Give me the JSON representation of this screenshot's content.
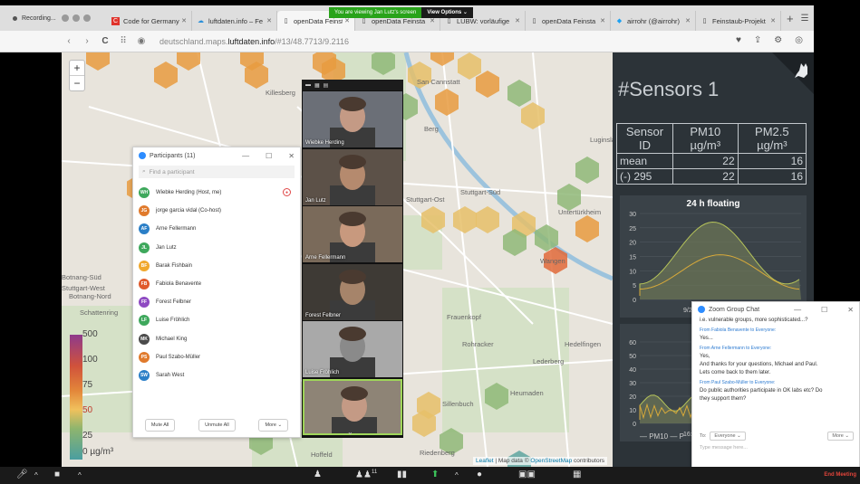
{
  "share_banner": {
    "text": "You are viewing Jan Lutz's screen",
    "button": "View Options ⌄"
  },
  "recording": {
    "label": "Recording..."
  },
  "tabs": [
    {
      "label": "Code for Germany",
      "icon": "code-for-germany-icon",
      "active": false
    },
    {
      "label": "luftdaten.info – Fe",
      "icon": "cloud-icon",
      "active": false
    },
    {
      "label": "openData Feinsta",
      "icon": "page-icon",
      "active": true
    },
    {
      "label": "openData Feinsta",
      "icon": "page-icon",
      "active": false
    },
    {
      "label": "LUBW: vorläufige",
      "icon": "page-icon",
      "active": false
    },
    {
      "label": "openData Feinsta",
      "icon": "page-icon",
      "active": false
    },
    {
      "label": "airrohr (@airrohr)",
      "icon": "twitter-bird-icon",
      "active": false
    },
    {
      "label": "Feinstaub-Projekt",
      "icon": "page-icon",
      "active": false
    }
  ],
  "url": {
    "prefix": "deutschland.maps.",
    "domain": "luftdaten.info",
    "path": "/#13/48.7713/9.2116"
  },
  "map": {
    "labels": [
      "San Cannstatt",
      "Berg",
      "Luginsland",
      "Stuttgart-Ost",
      "Untertürkheim",
      "Wangen",
      "Stuttgart-Süd",
      "Frauenkopf",
      "Rohracker",
      "Hedelfingen",
      "Lederberg",
      "Heumaden",
      "Sillenbuch",
      "Hoffeld",
      "Riedenberg",
      "Botnang-Süd",
      "Stuttgart-West",
      "Botnang-Nord",
      "Schattenring",
      "Killesberg",
      "Stuttgart-Nord"
    ],
    "legend_ticks": [
      "500",
      "100",
      "75",
      "50",
      "25",
      "0 µg/m³"
    ],
    "attribution_leaflet": "Leaflet",
    "attribution_text": " | Map data © ",
    "attribution_osm": "OpenStreetMap",
    "attribution_end": " contributors",
    "zoom_in": "+",
    "zoom_out": "−"
  },
  "sensor_panel": {
    "title": "#Sensors 1",
    "headers": [
      "Sensor ID",
      "PM10 µg/m³",
      "PM2.5 µg/m³"
    ],
    "rows": [
      {
        "id": "mean",
        "pm10": "22",
        "pm25": "16"
      },
      {
        "id": "(-) 295",
        "pm10": "22",
        "pm25": "16"
      }
    ],
    "chart1_title": "24 h floating",
    "chart1_ticks": [
      "30",
      "25",
      "20",
      "15",
      "10",
      "5",
      "0"
    ],
    "chart1_xlabel": "9/2",
    "chart2_title": "La",
    "chart2_ticks": [
      "60",
      "50",
      "40",
      "30",
      "20",
      "10",
      "0"
    ],
    "chart2_xlabel": "16:00",
    "legend": "— PM10  — P"
  },
  "video": {
    "header_icons": [
      "minimize-icon",
      "grid-icon",
      "gallery-icon"
    ],
    "tiles": [
      {
        "name": "Wiebke Herding",
        "skin": "#c49a85",
        "bg": "#6b6f77",
        "active": false
      },
      {
        "name": "Jan Lutz",
        "skin": "#b58a6e",
        "bg": "#5c5148",
        "active": false
      },
      {
        "name": "Arne Fellermann",
        "skin": "#c8997e",
        "bg": "#7a6a5a",
        "active": false
      },
      {
        "name": "Forest Felbner",
        "skin": "#a6846a",
        "bg": "#3e3a35",
        "active": false
      },
      {
        "name": "Luise Fröhlich",
        "skin": "#8a8a8a",
        "bg": "#a9a9a9",
        "active": false
      },
      {
        "name": "",
        "skin": "#c49a85",
        "bg": "#8e8476",
        "active": true
      }
    ]
  },
  "participants": {
    "title": "Participants (11)",
    "find_placeholder": "Find a participant",
    "list": [
      {
        "initials": "WH",
        "name": "Wiebke Herding (Host, me)",
        "color": "#3ea85c",
        "mic_muted": true
      },
      {
        "initials": "JG",
        "name": "jorge garcia vidal (Co-host)",
        "color": "#e07a2c",
        "mic_muted": false
      },
      {
        "initials": "AF",
        "name": "Arne Fellermann",
        "color": "#2b7fc7",
        "mic_muted": false
      },
      {
        "initials": "JL",
        "name": "Jan Lutz",
        "color": "#3ea85c",
        "mic_muted": false
      },
      {
        "initials": "BF",
        "name": "Barak Fishbain",
        "color": "#f0a82c",
        "mic_muted": false
      },
      {
        "initials": "FB",
        "name": "Fabiola Benavente",
        "color": "#e05a2c",
        "mic_muted": false
      },
      {
        "initials": "FF",
        "name": "Forest Felbner",
        "color": "#8e4ac2",
        "mic_muted": false
      },
      {
        "initials": "LF",
        "name": "Luise Fröhlich",
        "color": "#3ea85c",
        "mic_muted": false
      },
      {
        "initials": "MK",
        "name": "Michael King",
        "color": "#4b4b4b",
        "mic_muted": false
      },
      {
        "initials": "PS",
        "name": "Paul Szabo-Müller",
        "color": "#e07a2c",
        "mic_muted": false
      },
      {
        "initials": "SW",
        "name": "Sarah West",
        "color": "#2b7fc7",
        "mic_muted": false
      }
    ],
    "mute_all": "Mute All",
    "unmute_all": "Unmute All",
    "more": "More ⌄"
  },
  "chat": {
    "title": "Zoom Group Chat",
    "messages": [
      {
        "from": "",
        "lines": [
          "i.e. vulnerable groups, more sophisticated...?"
        ]
      },
      {
        "from": "From Fabiola Benavente to Everyone:",
        "lines": [
          "Yes..."
        ]
      },
      {
        "from": "From Arne Fellermann to Everyone:",
        "lines": [
          "Yes,",
          "And thanks for your questions, Michael and Paul.",
          "Lets come back to them later."
        ]
      },
      {
        "from": "From Paul Szabo-Müller to Everyone:",
        "lines": [
          "Do public authorities participate in OK labs etc? Do",
          "they support them?"
        ]
      }
    ],
    "to_label": "To:",
    "to_value": "Everyone ⌄",
    "more": "More ⌄",
    "input_placeholder": "Type message here..."
  },
  "toolbar": {
    "participants_count": "11",
    "end_meeting": "End Meeting"
  }
}
